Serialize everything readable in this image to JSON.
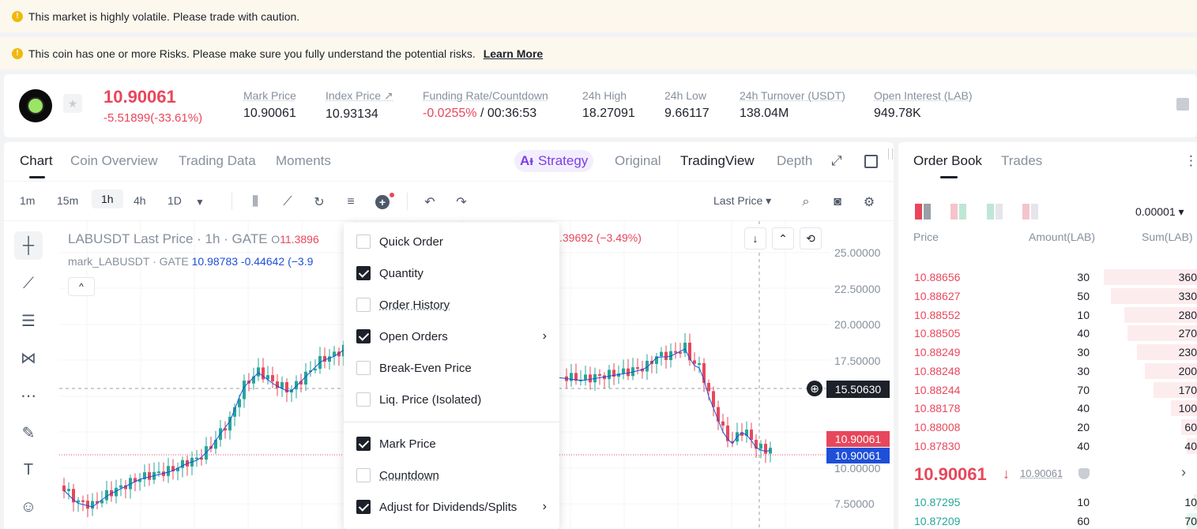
{
  "banners": {
    "volatility": "This market is highly volatile. Please trade with caution.",
    "risk": "This coin has one or more Risks. Please make sure you fully understand the potential risks.",
    "risk_link": "Learn More"
  },
  "ticker": {
    "last_price": "10.90061",
    "change": "-5.51899(-33.61%)",
    "stats": [
      {
        "label": "Mark Price",
        "value": "10.90061"
      },
      {
        "label": "Index Price ↗",
        "value": "10.93134"
      },
      {
        "label": "Funding Rate/Countdown",
        "value_neg": "-0.0255%",
        "value": " / 00:36:53"
      },
      {
        "label": "24h High",
        "value": "18.27091"
      },
      {
        "label": "24h Low",
        "value": "9.66117"
      },
      {
        "label": "24h Turnover (USDT)",
        "value": "138.04M"
      },
      {
        "label": "Open Interest (LAB)",
        "value": "949.78K"
      }
    ]
  },
  "chart_tabs": [
    "Chart",
    "Coin Overview",
    "Trading Data",
    "Moments"
  ],
  "view_tabs": {
    "strategy_ai": "Aᵻ",
    "strategy": "Strategy",
    "original": "Original",
    "tradingview": "TradingView",
    "depth": "Depth"
  },
  "timeframes": [
    "1m",
    "15m",
    "1h",
    "4h",
    "1D"
  ],
  "price_type": "Last Price ▾",
  "legend": {
    "title": "LABUSDT Last Price · 1h · GATE",
    "open_label": "O",
    "open_value": "11.3896",
    "mark_name": "mark_LABUSDT · GATE",
    "mark_values": "10.98783 -0.44642 (−3.9",
    "change_right": ".39692 (−3.49%)"
  },
  "y_axis": [
    "25.00000",
    "22.50000",
    "20.00000",
    "17.50000",
    "10.00000",
    "7.50000"
  ],
  "price_tags": {
    "crosshair": "15.50630",
    "last": "10.90061",
    "mark": "10.90061"
  },
  "colors": {
    "up": "#26a69a",
    "down": "#e8475b",
    "mark_line": "#1e4fd8",
    "accent": "#7b3fe4"
  },
  "menu": [
    {
      "label": "Quick Order",
      "checked": false,
      "dotted": false,
      "arrow": false
    },
    {
      "label": "Quantity",
      "checked": true,
      "dotted": false,
      "arrow": false
    },
    {
      "label": "Order History",
      "checked": false,
      "dotted": true,
      "arrow": false
    },
    {
      "label": "Open Orders",
      "checked": true,
      "dotted": false,
      "arrow": true
    },
    {
      "label": "Break-Even Price",
      "checked": false,
      "dotted": false,
      "arrow": false
    },
    {
      "label": "Liq. Price (Isolated)",
      "checked": false,
      "dotted": false,
      "arrow": false
    },
    {
      "label": "Mark Price",
      "checked": true,
      "dotted": false,
      "arrow": false
    },
    {
      "label": "Countdown",
      "checked": false,
      "dotted": true,
      "arrow": false
    },
    {
      "label": "Adjust for Dividends/Splits",
      "checked": true,
      "dotted": false,
      "arrow": true
    }
  ],
  "order_book": {
    "tabs": [
      "Order Book",
      "Trades"
    ],
    "precision": "0.00001 ▾",
    "headers": {
      "price": "Price",
      "amount": "Amount(LAB)",
      "sum": "Sum(LAB)"
    },
    "asks": [
      {
        "price": "10.88656",
        "amount": "30",
        "sum": "360",
        "depth": 1.0
      },
      {
        "price": "10.88627",
        "amount": "50",
        "sum": "330",
        "depth": 0.92
      },
      {
        "price": "10.88552",
        "amount": "10",
        "sum": "280",
        "depth": 0.78
      },
      {
        "price": "10.88505",
        "amount": "40",
        "sum": "270",
        "depth": 0.75
      },
      {
        "price": "10.88249",
        "amount": "30",
        "sum": "230",
        "depth": 0.64
      },
      {
        "price": "10.88248",
        "amount": "30",
        "sum": "200",
        "depth": 0.56
      },
      {
        "price": "10.88244",
        "amount": "70",
        "sum": "170",
        "depth": 0.47
      },
      {
        "price": "10.88178",
        "amount": "40",
        "sum": "100",
        "depth": 0.28
      },
      {
        "price": "10.88008",
        "amount": "20",
        "sum": "60",
        "depth": 0.17
      },
      {
        "price": "10.87830",
        "amount": "40",
        "sum": "40",
        "depth": 0.11
      }
    ],
    "mid_price": "10.90061",
    "mid_arrow": "↓",
    "mid_mark": "10.90061",
    "bids": [
      {
        "price": "10.87295",
        "amount": "10",
        "sum": "10",
        "depth": 0.03
      },
      {
        "price": "10.87209",
        "amount": "60",
        "sum": "70",
        "depth": 0.11
      }
    ]
  }
}
